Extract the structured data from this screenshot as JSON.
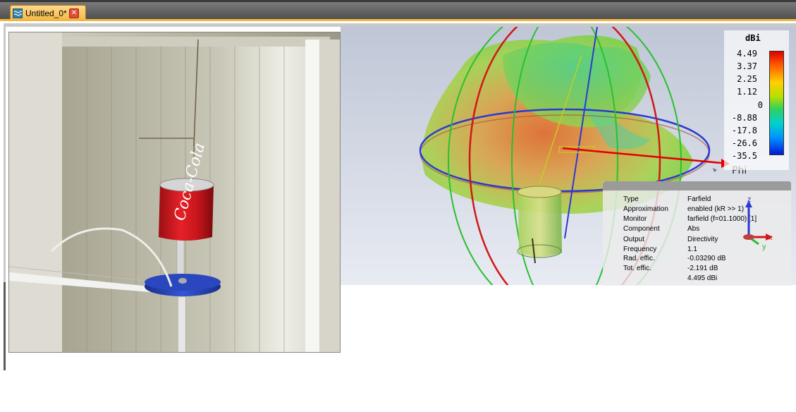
{
  "tab": {
    "title": "Untitled_0*",
    "icon": "waves-icon",
    "close_icon": "close-icon"
  },
  "photo": {
    "description_icon": "photo-image",
    "can_label": "Coca-Cola"
  },
  "farfield": {
    "phi_label": "Phi",
    "colorbar": {
      "title": "dBi",
      "ticks": [
        "4.49",
        "3.37",
        "2.25",
        "1.12",
        "0",
        "-8.88",
        "-17.8",
        "-26.6",
        "-35.5"
      ],
      "colors": [
        "#e00000",
        "#ff6000",
        "#ffd000",
        "#b6e000",
        "#30d060",
        "#00d0d0",
        "#0090ff",
        "#0018d8"
      ]
    },
    "info": [
      {
        "label": "Type",
        "value": "Farfield"
      },
      {
        "label": "Approximation",
        "value": "enabled (kR >> 1)"
      },
      {
        "label": "Monitor",
        "value": "farfield (f=01.1000) [1]"
      },
      {
        "label": "Component",
        "value": "Abs"
      },
      {
        "label": "Output",
        "value": "Directivity"
      },
      {
        "label": "Frequency",
        "value": "1.1"
      },
      {
        "label": "Rad. effic.",
        "value": "-0.03290 dB"
      },
      {
        "label": "Tot. effic.",
        "value": "-2.191 dB"
      },
      {
        "label": "",
        "value": "4.495 dBi"
      }
    ],
    "axes": {
      "z": "z",
      "x": "x",
      "y": "y"
    }
  }
}
